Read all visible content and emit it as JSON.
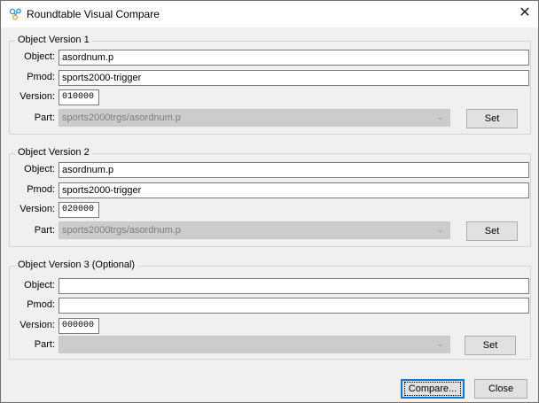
{
  "window": {
    "title": "Roundtable Visual Compare",
    "close_label": "✕"
  },
  "labels": {
    "object": "Object:",
    "pmod": "Pmod:",
    "version": "Version:",
    "part": "Part:",
    "set": "Set"
  },
  "groups": [
    {
      "legend": "Object Version 1",
      "object": "asordnum.p",
      "pmod": "sports2000-trigger",
      "version": "010000",
      "part": "sports2000trgs/asordnum.p"
    },
    {
      "legend": "Object Version 2",
      "object": "asordnum.p",
      "pmod": "sports2000-trigger",
      "version": "020000",
      "part": "sports2000trgs/asordnum.p"
    },
    {
      "legend": "Object Version 3 (Optional)",
      "object": "",
      "pmod": "",
      "version": "000000",
      "part": ""
    }
  ],
  "footer": {
    "compare_label": "Compare...",
    "close_label": "Close"
  }
}
